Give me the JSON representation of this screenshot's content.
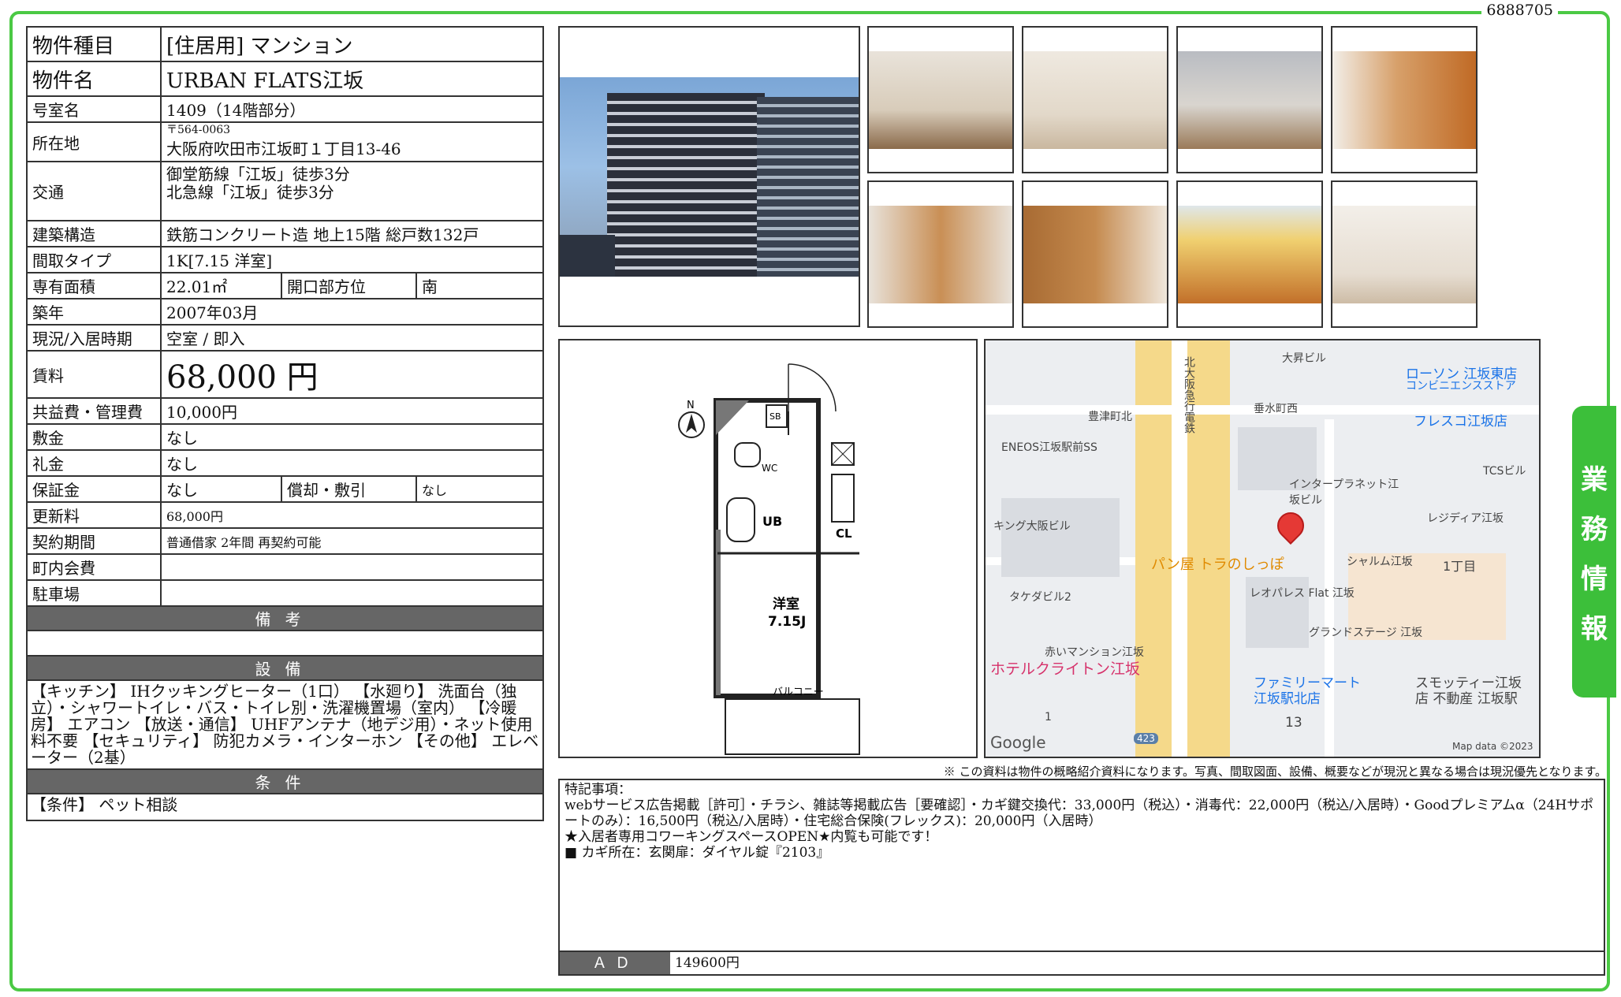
{
  "doc_number": "6888705",
  "side_tab": [
    "業",
    "務",
    "情",
    "報"
  ],
  "info": {
    "type_label": "物件種目",
    "type_value": "[住居用] マンション",
    "name_label": "物件名",
    "name_value": "URBAN FLATS江坂",
    "room_label": "号室名",
    "room_value": "1409（14階部分）",
    "addr_label": "所在地",
    "addr_zip": "〒564-0063",
    "addr_value": "大阪府吹田市江坂町１丁目13-46",
    "access_label": "交通",
    "access_1": "御堂筋線「江坂」徒歩3分",
    "access_2": "北急線「江坂」徒歩3分",
    "struct_label": "建築構造",
    "struct_value": "鉄筋コンクリート造 地上15階 総戸数132戸",
    "layout_label": "間取タイプ",
    "layout_value": "1K[7.15 洋室]",
    "area_label": "専有面積",
    "area_value": "22.01㎡",
    "dir_label": "開口部方位",
    "dir_value": "南",
    "built_label": "築年",
    "built_value": "2007年03月",
    "status_label": "現況/入居時期",
    "status_value": "空室 / 即入",
    "rent_label": "賃料",
    "rent_value": "68,000 円",
    "fee_label": "共益費・管理費",
    "fee_value": "10,000円",
    "deposit_label": "敷金",
    "deposit_value": "なし",
    "key_label": "礼金",
    "key_value": "なし",
    "guar_label": "保証金",
    "guar_value": "なし",
    "amort_label": "償却・敷引",
    "amort_value": "なし",
    "renew_label": "更新料",
    "renew_value": "68,000円",
    "term_label": "契約期間",
    "term_value": "普通借家 2年間 再契約可能",
    "assoc_label": "町内会費",
    "assoc_value": "",
    "parking_label": "駐車場",
    "parking_value": "",
    "biko_title": "備考",
    "biko_value": "",
    "equip_title": "設備",
    "equip_value": "【キッチン】 IHクッキングヒーター（1口） 【水廻り】 洗面台（独立）・シャワートイレ・バス・トイレ別・洗濯機置場（室内） 【冷暖房】 エアコン 【放送・通信】 UHFアンテナ（地デジ用）・ネット使用料不要 【セキュリティ】 防犯カメラ・インターホン 【その他】 エレベーター（2基）",
    "cond_title": "条件",
    "cond_value": "【条件】 ペット相談"
  },
  "floorplan": {
    "room_name": "洋室",
    "room_size": "7.15J",
    "balcony": "バルコニー",
    "ub": "UB",
    "wc": "WC",
    "cl": "CL",
    "sb": "SB",
    "north": "N"
  },
  "map": {
    "labels": [
      "大昇ビル",
      "ローソン 江坂東店",
      "コンビニエンスストア",
      "豊津町北",
      "垂水町西",
      "フレスコ江坂店",
      "ENEOS江坂駅前SS",
      "北大阪急行電鉄",
      "TCSビル",
      "インタープラネット江坂ビル",
      "キング大阪ビル",
      "レジディア江坂",
      "パン屋 トラのしっぽ",
      "シャルム江坂",
      "1丁目",
      "タケダビル2",
      "レオパレス Flat 江坂",
      "グランドステージ 江坂",
      "赤いマンション江坂",
      "ホテルクライトン江坂",
      "ファミリーマート",
      "江坂駅北店",
      "スモッティー江坂",
      "店 不動産 江坂駅",
      "1",
      "13",
      "423",
      "Google",
      "Map data ©2023"
    ]
  },
  "disclaimer": "※ この資料は物件の概略紹介資料になります。写真、間取図面、設備、概要などが現況と異なる場合は現況優先となります。",
  "remarks": {
    "text": "特記事項：\nwebサービス広告掲載［許可］・チラシ、雑誌等掲載広告［要確認］・カギ鍵交換代：33,000円（税込）・消毒代：22,000円（税込/入居時）・Goodプレミアムα（24Hサポートのみ）：16,500円（税込/入居時）・住宅総合保険(フレックス)：20,000円（入居時）\n★入居者専用コワーキングスペースOPEN★内覧も可能です！\n■ カギ所在：玄関扉：ダイヤル錠『2103』",
    "ad_label": "ＡＤ",
    "ad_value": "149600円"
  }
}
